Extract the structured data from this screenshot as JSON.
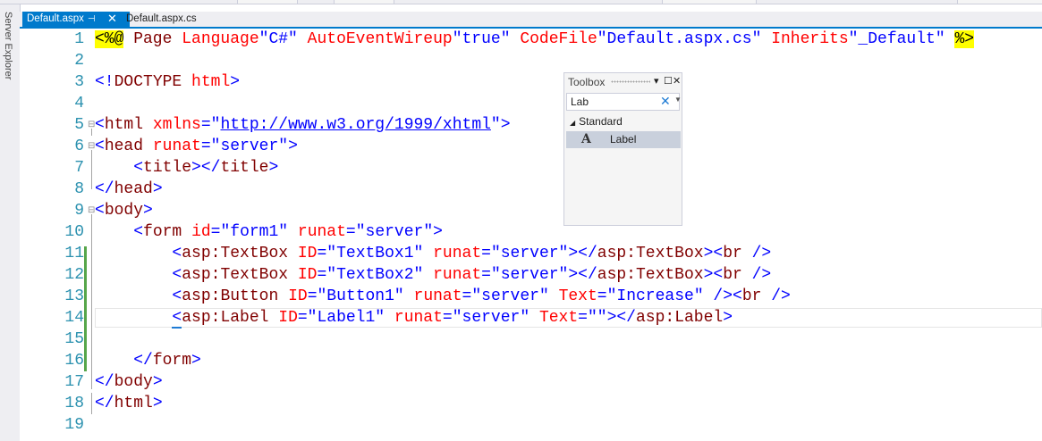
{
  "sidebar": {
    "label": "Server Explorer"
  },
  "tabs": [
    {
      "label": "Default.aspx",
      "pin": "⊣",
      "close": "✕"
    },
    {
      "label": "Default.aspx.cs"
    }
  ],
  "lines": [
    "1",
    "2",
    "3",
    "4",
    "5",
    "6",
    "7",
    "8",
    "9",
    "10",
    "11",
    "12",
    "13",
    "14",
    "15",
    "16",
    "17",
    "18",
    "19"
  ],
  "code": {
    "l1": {
      "open": "<%@",
      "p1": " Page ",
      "a1": "Language",
      "v1": "\"C#\"",
      "a2": "AutoEventWireup",
      "v2": "\"true\"",
      "a3": "CodeFile",
      "v3": "\"Default.aspx.cs\"",
      "a4": "Inherits",
      "v4": "\"_Default\"",
      "close": "%>"
    },
    "l3": {
      "open": "<!",
      "tag": "DOCTYPE",
      "attr": "html",
      "close": ">"
    },
    "l5": {
      "open": "<",
      "tag": "html",
      "attr": "xmlns",
      "eq": "=\"",
      "link": "http://www.w3.org/1999/xhtml",
      "close": "\">"
    },
    "l6": {
      "open": "<",
      "tag": "head",
      "attr": "runat",
      "val": "=\"server\"",
      "close": ">"
    },
    "l7": {
      "o1": "<",
      "tag": "title",
      "c1": "></",
      "tag2": "title",
      "c2": ">"
    },
    "l8": {
      "open": "</",
      "tag": "head",
      "close": ">"
    },
    "l9": {
      "open": "<",
      "tag": "body",
      "close": ">"
    },
    "l10": {
      "open": "<",
      "tag": "form",
      "a1": "id",
      "v1": "=\"form1\"",
      "a2": "runat",
      "v2": "=\"server\"",
      "close": ">"
    },
    "l11": {
      "open": "<",
      "tag": "asp:TextBox",
      "a1": "ID",
      "v1": "=\"TextBox1\"",
      "a2": "runat",
      "v2": "=\"server\"",
      "c1": "></",
      "tag2": "asp:TextBox",
      "c2": "><",
      "tag3": "br",
      "c3": " />"
    },
    "l12": {
      "open": "<",
      "tag": "asp:TextBox",
      "a1": "ID",
      "v1": "=\"TextBox2\"",
      "a2": "runat",
      "v2": "=\"server\"",
      "c1": "></",
      "tag2": "asp:TextBox",
      "c2": "><",
      "tag3": "br",
      "c3": " />"
    },
    "l13": {
      "open": "<",
      "tag": "asp:Button",
      "a1": "ID",
      "v1": "=\"Button1\"",
      "a2": "runat",
      "v2": "=\"server\"",
      "a3": "Text",
      "v3": "=\"Increase\"",
      "c1": " /><",
      "tag3": "br",
      "c3": " />"
    },
    "l14": {
      "open": "<",
      "tag": "asp:Label",
      "a1": "ID",
      "v1": "=\"Label1\"",
      "a2": "runat",
      "v2": "=\"server\"",
      "a3": "Text",
      "v3": "=\"\"",
      "c1": "></",
      "tag2": "asp:Label",
      "c2": ">"
    },
    "l16": {
      "open": "</",
      "tag": "form",
      "close": ">"
    },
    "l17": {
      "open": "</",
      "tag": "body",
      "close": ">"
    },
    "l18": {
      "open": "</",
      "tag": "html",
      "close": ">"
    }
  },
  "toolbox": {
    "title": "Toolbox",
    "dropdown_icon": "▾",
    "maximize_icon": "☐",
    "close_icon": "✕",
    "search_value": "Lab",
    "clear_icon": "✕",
    "search_dropdown": "▼",
    "group": "Standard",
    "group_icon": "◢",
    "item_icon": "A",
    "item_label": "Label"
  }
}
